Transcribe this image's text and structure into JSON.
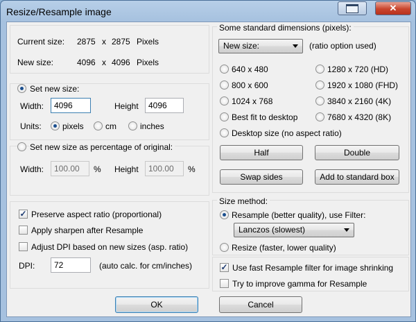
{
  "window": {
    "title": "Resize/Resample image",
    "close_glyph": "✕"
  },
  "sizes": {
    "current_label": "Current size:",
    "current_w": "2875",
    "current_x": "x",
    "current_h": "2875",
    "current_unit": "Pixels",
    "new_label": "New size:",
    "new_w": "4096",
    "new_x": "x",
    "new_h": "4096",
    "new_unit": "Pixels"
  },
  "set_new": {
    "radio_label": "Set new size:",
    "selected": true,
    "width_label": "Width:",
    "width_value": "4096",
    "height_label": "Height",
    "height_value": "4096",
    "units_label": "Units:",
    "units": [
      "pixels",
      "cm",
      "inches"
    ],
    "units_selected": "pixels"
  },
  "percent": {
    "radio_label": "Set new size as percentage of original:",
    "width_label": "Width:",
    "width_value": "100.00",
    "width_unit": "%",
    "height_label": "Height",
    "height_value": "100.00",
    "height_unit": "%"
  },
  "options": {
    "preserve_label": "Preserve aspect ratio (proportional)",
    "preserve": true,
    "sharpen_label": "Apply sharpen after Resample",
    "sharpen": false,
    "dpi_adjust_label": "Adjust DPI based on new sizes (asp. ratio)",
    "dpi_adjust": false,
    "dpi_label": "DPI:",
    "dpi_value": "72",
    "dpi_note": "(auto calc. for cm/inches)"
  },
  "standard": {
    "group_label": "Some standard dimensions (pixels):",
    "combo_value": "New size:",
    "ratio_note": "(ratio option used)",
    "dims": [
      "640 x 480",
      "800 x 600",
      "1024 x 768",
      "Best fit to desktop",
      "1280 x 720  (HD)",
      "1920 x 1080 (FHD)",
      "3840 x 2160 (4K)",
      "7680 x 4320 (8K)"
    ],
    "desktop_label": "Desktop size (no aspect ratio)",
    "half": "Half",
    "double": "Double",
    "swap": "Swap sides",
    "add": "Add to standard box"
  },
  "method": {
    "group_label": "Size method:",
    "resample_label": "Resample (better quality), use Filter:",
    "resample_selected": true,
    "filter_value": "Lanczos (slowest)",
    "resize_label": "Resize (faster, lower quality)",
    "fast_label": "Use fast Resample filter for image shrinking",
    "fast": true,
    "gamma_label": "Try to improve gamma for Resample",
    "gamma": false
  },
  "buttons": {
    "ok": "OK",
    "cancel": "Cancel"
  }
}
